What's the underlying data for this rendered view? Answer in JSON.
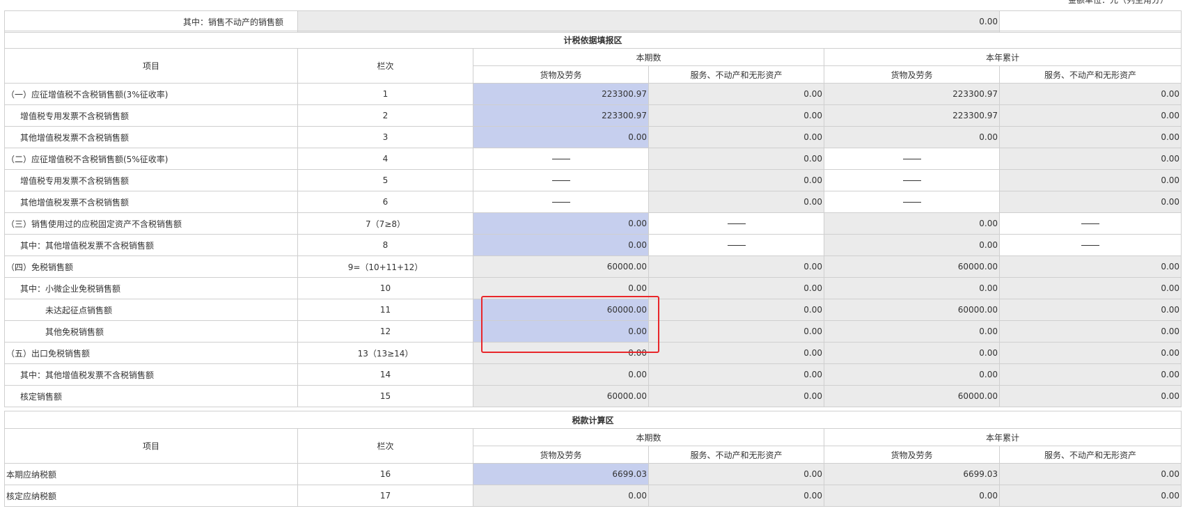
{
  "top_note": "金额单位：元（列至角分）",
  "first_row": {
    "label": "其中：销售不动产的销售额",
    "value": "0.00"
  },
  "section1": {
    "title": "计税依据填报区",
    "headers": {
      "item": "项目",
      "line": "栏次",
      "current": "本期数",
      "ytd": "本年累计",
      "goods": "货物及劳务",
      "services": "服务、不动产和无形资产"
    },
    "rows": [
      {
        "label": "（一）应征增值税不含税销售额(3%征收率)",
        "line": "1",
        "cg": "223300.97",
        "cs": "0.00",
        "yg": "223300.97",
        "ys": "0.00"
      },
      {
        "label": "增值税专用发票不含税销售额",
        "line": "2",
        "cg": "223300.97",
        "cs": "0.00",
        "yg": "223300.97",
        "ys": "0.00"
      },
      {
        "label": "其他增值税发票不含税销售额",
        "line": "3",
        "cg": "0.00",
        "cs": "0.00",
        "yg": "0.00",
        "ys": "0.00"
      },
      {
        "label": "（二）应征增值税不含税销售额(5%征收率)",
        "line": "4",
        "cg": "",
        "cs": "0.00",
        "yg": "",
        "ys": "0.00"
      },
      {
        "label": "增值税专用发票不含税销售额",
        "line": "5",
        "cg": "",
        "cs": "0.00",
        "yg": "",
        "ys": "0.00"
      },
      {
        "label": "其他增值税发票不含税销售额",
        "line": "6",
        "cg": "",
        "cs": "0.00",
        "yg": "",
        "ys": "0.00"
      },
      {
        "label": "（三）销售使用过的应税固定资产不含税销售额",
        "line": "7（7≥8）",
        "cg": "0.00",
        "cs": "",
        "yg": "0.00",
        "ys": ""
      },
      {
        "label": "其中：其他增值税发票不含税销售额",
        "line": "8",
        "cg": "0.00",
        "cs": "",
        "yg": "0.00",
        "ys": ""
      },
      {
        "label": "（四）免税销售额",
        "line": "9=（10+11+12）",
        "cg": "60000.00",
        "cs": "0.00",
        "yg": "60000.00",
        "ys": "0.00"
      },
      {
        "label": "其中：小微企业免税销售额",
        "line": "10",
        "cg": "0.00",
        "cs": "0.00",
        "yg": "0.00",
        "ys": "0.00"
      },
      {
        "label": "未达起征点销售额",
        "line": "11",
        "cg": "60000.00",
        "cs": "0.00",
        "yg": "60000.00",
        "ys": "0.00"
      },
      {
        "label": "其他免税销售额",
        "line": "12",
        "cg": "0.00",
        "cs": "0.00",
        "yg": "0.00",
        "ys": "0.00"
      },
      {
        "label": "（五）出口免税销售额",
        "line": "13（13≥14）",
        "cg": "0.00",
        "cs": "0.00",
        "yg": "0.00",
        "ys": "0.00"
      },
      {
        "label": "其中：其他增值税发票不含税销售额",
        "line": "14",
        "cg": "0.00",
        "cs": "0.00",
        "yg": "0.00",
        "ys": "0.00"
      },
      {
        "label": "核定销售额",
        "line": "15",
        "cg": "60000.00",
        "cs": "0.00",
        "yg": "60000.00",
        "ys": "0.00"
      }
    ]
  },
  "section2": {
    "title": "税款计算区",
    "headers": {
      "item": "项目",
      "line": "栏次",
      "current": "本期数",
      "ytd": "本年累计",
      "goods": "货物及劳务",
      "services": "服务、不动产和无形资产"
    },
    "rows": [
      {
        "label": "本期应纳税额",
        "line": "16",
        "cg": "6699.03",
        "cs": "0.00",
        "yg": "6699.03",
        "ys": "0.00"
      },
      {
        "label": "核定应纳税额",
        "line": "17",
        "cg": "0.00",
        "cs": "0.00",
        "yg": "0.00",
        "ys": "0.00"
      }
    ]
  },
  "colors": {
    "editable_cell": "#c6cfee",
    "readonly_cell": "#ebebeb",
    "highlight_box": "#e8262a",
    "border": "#cfcfcf"
  }
}
